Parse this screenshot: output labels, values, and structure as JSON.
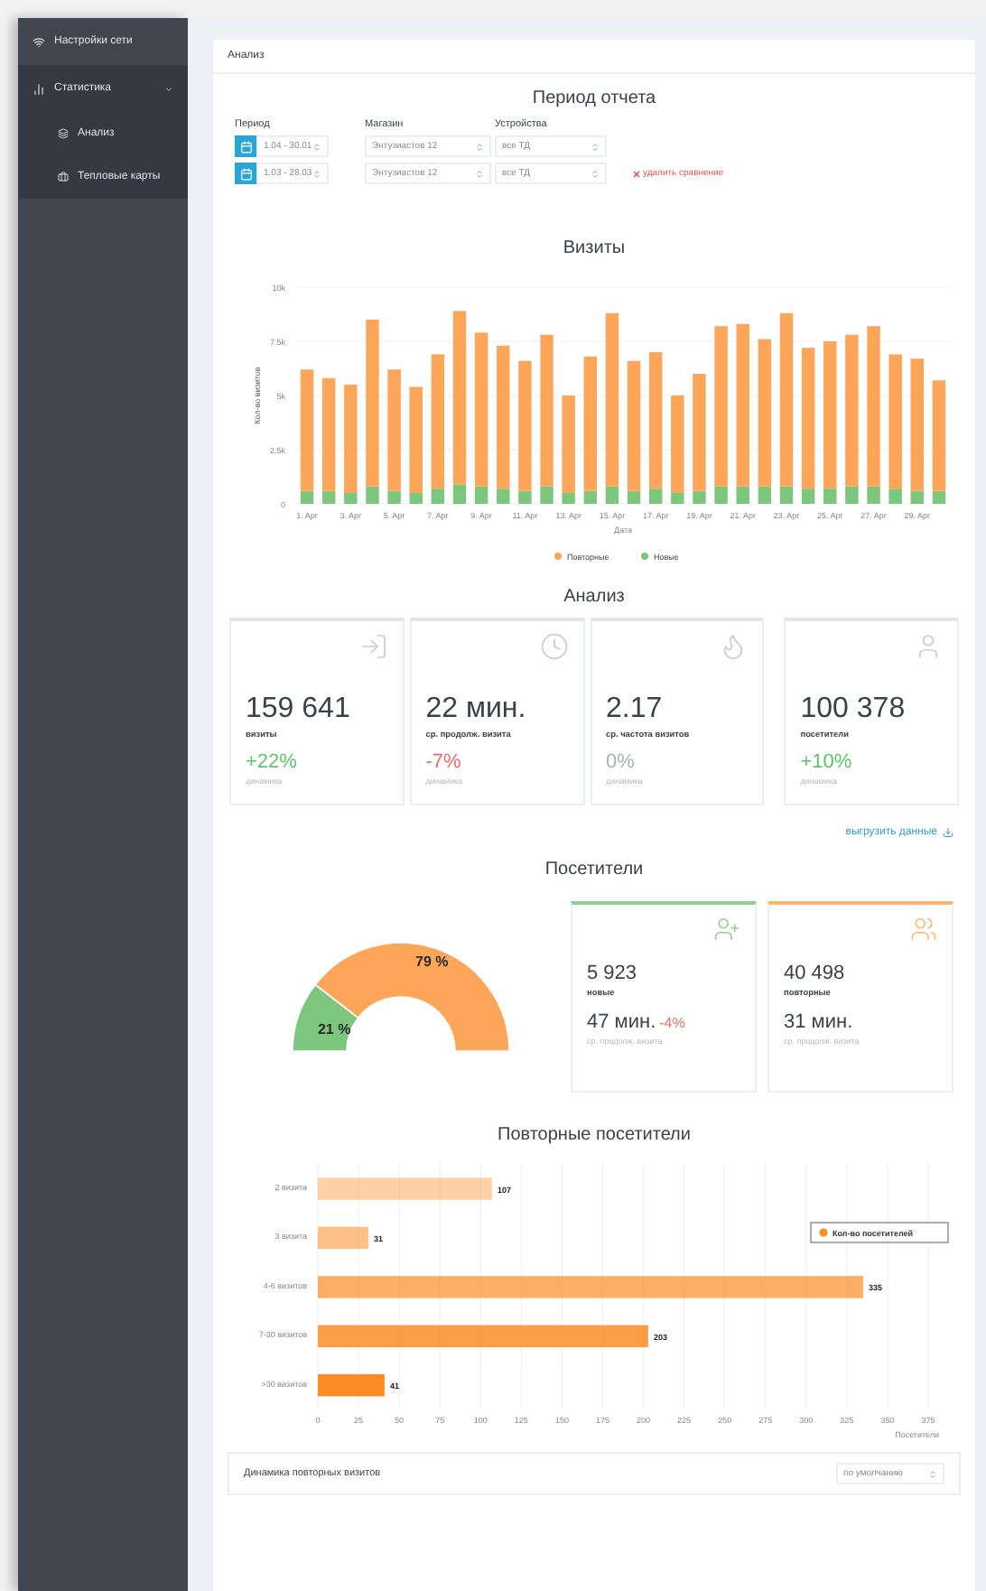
{
  "sidebar": {
    "items": [
      {
        "label": "Настройки сети",
        "expanded": false
      },
      {
        "label": "Статистика",
        "expanded": true,
        "children": [
          {
            "label": "Анализ"
          },
          {
            "label": "Тепловые карты"
          }
        ]
      }
    ]
  },
  "breadcrumb": "Анализ",
  "report": {
    "title": "Период отчета",
    "labels": [
      "Период",
      "Магазин",
      "Устройства"
    ],
    "rows": [
      {
        "period": "1.04 - 30.01",
        "store": "Энтузиастов 12",
        "device": "все ТД"
      },
      {
        "period": "1.03 - 28.03",
        "store": "Энтузиастов 12",
        "device": "все ТД",
        "remove": "удалить сравнение"
      }
    ]
  },
  "visits": {
    "title": "Визиты",
    "chart_data": {
      "type": "bar",
      "stacked": true,
      "grid": true,
      "legend": "bottom",
      "xlabel": "Дата",
      "ylabel": "Кол-во визитов",
      "categories": [
        "1. Apr",
        null,
        "3. Apr",
        null,
        "5. Apr",
        null,
        "7. Apr",
        null,
        "9. Apr",
        null,
        "11. Apr",
        null,
        "13. Apr",
        null,
        "15. Apr",
        null,
        "17. Apr",
        null,
        "19. Apr",
        null,
        "21. Apr",
        null,
        "23. Apr",
        null,
        "25. Apr",
        null,
        "27. Apr",
        null,
        "29. Apr",
        null
      ],
      "ylim": [
        0,
        10000
      ],
      "yticks": [
        {
          "value": 0,
          "label": "0"
        },
        {
          "value": 2500,
          "label": "2.5k"
        },
        {
          "value": 5000,
          "label": "5k"
        },
        {
          "value": 7500,
          "label": "7.5k"
        },
        {
          "value": 10000,
          "label": "10k"
        }
      ],
      "series": [
        {
          "name": "Новые",
          "color": "#7cc67e",
          "values": [
            600,
            600,
            500,
            800,
            600,
            500,
            700,
            900,
            800,
            700,
            600,
            800,
            500,
            600,
            800,
            600,
            700,
            500,
            600,
            800,
            800,
            800,
            800,
            700,
            700,
            800,
            800,
            700,
            600,
            600
          ]
        },
        {
          "name": "Повторные",
          "color": "#fda65a",
          "values": [
            5600,
            5200,
            5000,
            7700,
            5600,
            4900,
            6200,
            8000,
            7100,
            6600,
            6000,
            7000,
            4500,
            6200,
            8000,
            6000,
            6300,
            4500,
            5400,
            7400,
            7500,
            6800,
            8000,
            6500,
            6800,
            7000,
            7400,
            6200,
            6100,
            5100
          ]
        }
      ]
    }
  },
  "analysis": {
    "title": "Анализ",
    "cards": [
      {
        "value": "159 641",
        "label": "визиты",
        "delta": "+22%",
        "color": "#5ec46b",
        "note": "динамика"
      },
      {
        "value": "22 мин.",
        "label": "ср. продолж. визита",
        "delta": "-7%",
        "color": "#ef6a6a",
        "note": "динамика"
      },
      {
        "value": "2.17",
        "label": "ср. частота визитов",
        "delta": "0%",
        "color": "#aab0b6",
        "note": "динамика"
      },
      {
        "value": "100 378",
        "label": "посетители",
        "delta": "+10%",
        "color": "#5ec46b",
        "note": "динамика"
      }
    ],
    "export": "выгрузить данные"
  },
  "visitors": {
    "title": "Посетители",
    "chart_data": {
      "type": "donut",
      "values": [
        21,
        79
      ],
      "value_labels": [
        "21 %",
        "79 %"
      ]
    },
    "cards": [
      {
        "color": "#8fd08f",
        "value": "5 923",
        "label": "новые",
        "time": "47 мин.",
        "delta": "-4%",
        "note": "ср. продолж. визита"
      },
      {
        "color": "#fdb56f",
        "value": "40 498",
        "label": "повторные",
        "time": "31 мин.",
        "note": "ср. продолж. визита"
      }
    ]
  },
  "repeat": {
    "title": "Повторные посетители",
    "chart_data": {
      "type": "bar",
      "orientation": "horizontal",
      "grid": true,
      "categories": [
        "2 визита",
        "3 визита",
        "4-6 визитов",
        "7-30 визитов",
        ">30 визитов"
      ],
      "series": [
        {
          "name": "Кол-во посетителей",
          "color": "#fd8c25",
          "values": [
            107,
            31,
            335,
            203,
            41
          ]
        }
      ],
      "data_labels": true,
      "xlabel": "Посетители",
      "xlim": [
        0,
        375
      ],
      "xticks": [
        0,
        25,
        50,
        75,
        100,
        125,
        150,
        175,
        200,
        225,
        250,
        275,
        300,
        325,
        350,
        375
      ]
    }
  },
  "dynamics": {
    "title": "Динамика повторных визитов",
    "select": "по умолчанию"
  }
}
